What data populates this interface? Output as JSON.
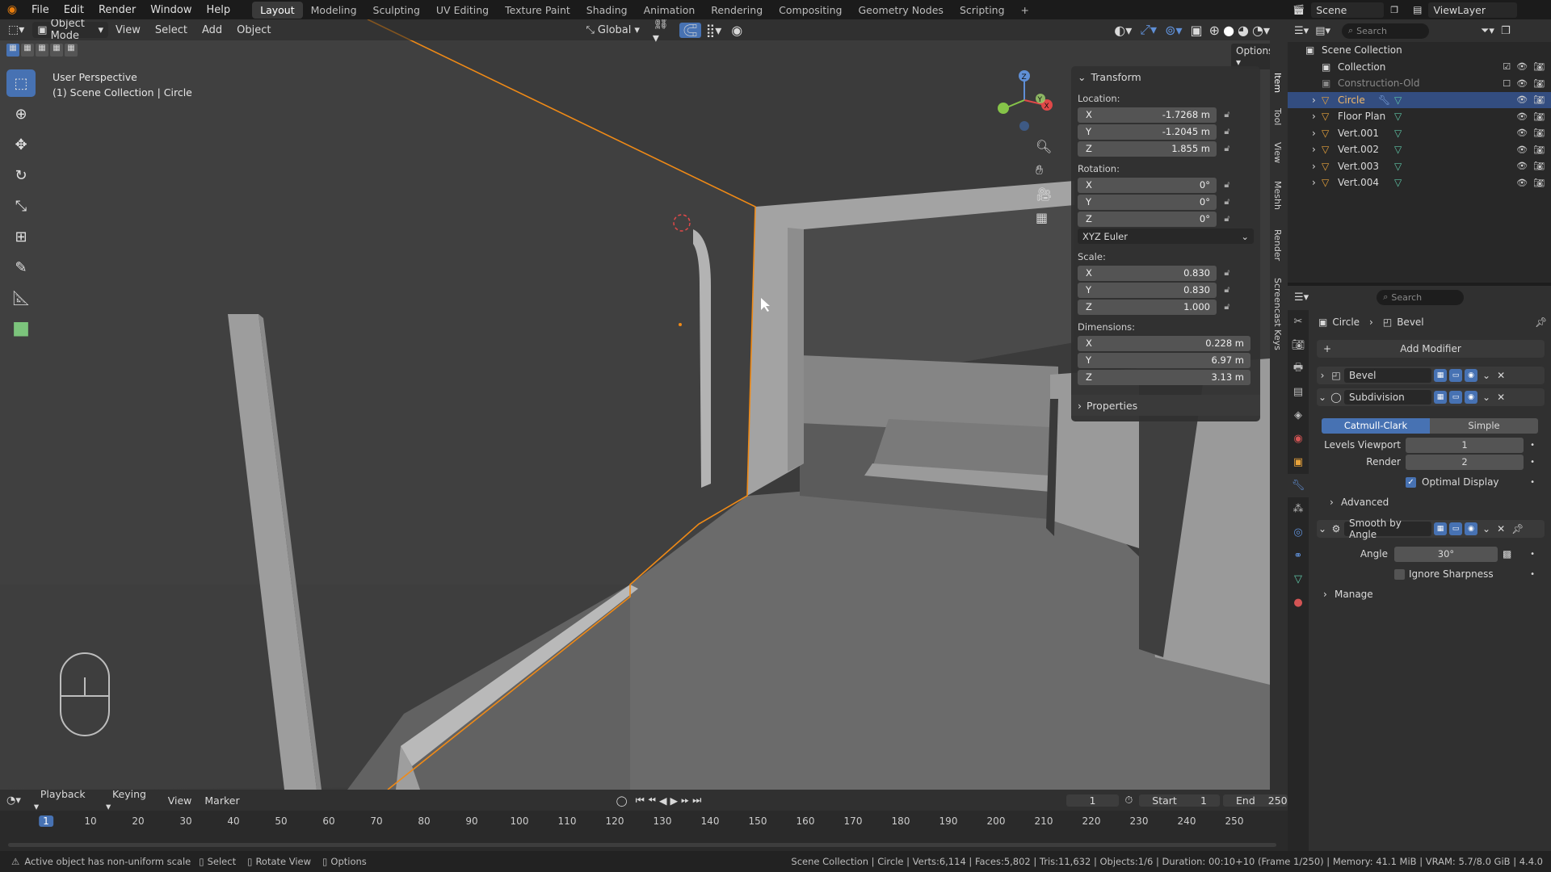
{
  "top_menu": [
    "File",
    "Edit",
    "Render",
    "Window",
    "Help"
  ],
  "workspaces": [
    "Layout",
    "Modeling",
    "Sculpting",
    "UV Editing",
    "Texture Paint",
    "Shading",
    "Animation",
    "Rendering",
    "Compositing",
    "Geometry Nodes",
    "Scripting"
  ],
  "active_workspace": "Layout",
  "add_workspace": "+",
  "scene": {
    "label": "Scene",
    "viewlayer": "ViewLayer"
  },
  "viewport": {
    "mode": "Object Mode",
    "menus": [
      "View",
      "Select",
      "Add",
      "Object"
    ],
    "orientation": "Global",
    "options": "Options",
    "info_line1": "User Perspective",
    "info_line2": "(1) Scene Collection | Circle",
    "gizmo": {
      "x": "X",
      "y": "Y",
      "z": "Z"
    }
  },
  "transform": {
    "header": "Transform",
    "location_label": "Location:",
    "location": [
      {
        "axis": "X",
        "value": "-1.7268 m"
      },
      {
        "axis": "Y",
        "value": "-1.2045 m"
      },
      {
        "axis": "Z",
        "value": "1.855 m"
      }
    ],
    "rotation_label": "Rotation:",
    "rotation": [
      {
        "axis": "X",
        "value": "0°"
      },
      {
        "axis": "Y",
        "value": "0°"
      },
      {
        "axis": "Z",
        "value": "0°"
      }
    ],
    "rotation_mode": "XYZ Euler",
    "scale_label": "Scale:",
    "scale": [
      {
        "axis": "X",
        "value": "0.830"
      },
      {
        "axis": "Y",
        "value": "0.830"
      },
      {
        "axis": "Z",
        "value": "1.000"
      }
    ],
    "dimensions_label": "Dimensions:",
    "dimensions": [
      {
        "axis": "X",
        "value": "0.228 m"
      },
      {
        "axis": "Y",
        "value": "6.97 m"
      },
      {
        "axis": "Z",
        "value": "3.13 m"
      }
    ],
    "properties": "Properties"
  },
  "side_tabs": [
    "Item",
    "Tool",
    "View",
    "Meshh",
    "Render",
    "Screencast Keys"
  ],
  "outliner": {
    "search_placeholder": "Search",
    "root": "Scene Collection",
    "items": [
      {
        "name": "Collection"
      },
      {
        "name": "Construction-Old"
      },
      {
        "name": "Circle"
      },
      {
        "name": "Floor Plan"
      },
      {
        "name": "Vert.001"
      },
      {
        "name": "Vert.002"
      },
      {
        "name": "Vert.003"
      },
      {
        "name": "Vert.004"
      }
    ]
  },
  "properties_panel": {
    "search_placeholder": "Search",
    "breadcrumb": [
      "Circle",
      "Bevel"
    ],
    "add_modifier": "Add Modifier",
    "modifiers": [
      "Bevel",
      "Subdivision",
      "Smooth by Angle"
    ],
    "subdiv_types": [
      "Catmull-Clark",
      "Simple"
    ],
    "levels_viewport_label": "Levels Viewport",
    "levels_viewport": "1",
    "render_label": "Render",
    "render": "2",
    "optimal_display": "Optimal Display",
    "advanced": "Advanced",
    "angle_label": "Angle",
    "angle": "30°",
    "ignore_sharpness": "Ignore Sharpness",
    "manage": "Manage"
  },
  "timeline": {
    "menus": [
      "Playback",
      "Keying",
      "View",
      "Marker"
    ],
    "current_frame": "1",
    "start_label": "Start",
    "start": "1",
    "end_label": "End",
    "end": "250",
    "ticks": [
      "10",
      "20",
      "30",
      "40",
      "50",
      "60",
      "70",
      "80",
      "90",
      "100",
      "110",
      "120",
      "130",
      "140",
      "150",
      "160",
      "170",
      "180",
      "190",
      "200",
      "210",
      "220",
      "230",
      "240",
      "250"
    ]
  },
  "statusbar": {
    "warning": "Active object has non-uniform scale",
    "select": "Select",
    "rotate": "Rotate View",
    "options": "Options",
    "stats": "Scene Collection | Circle | Verts:6,114 | Faces:5,802 | Tris:11,632 | Objects:1/6 | Duration: 00:10+10 (Frame 1/250) | Memory: 41.1 MiB | VRAM: 5.7/8.0 GiB | 4.4.0"
  }
}
